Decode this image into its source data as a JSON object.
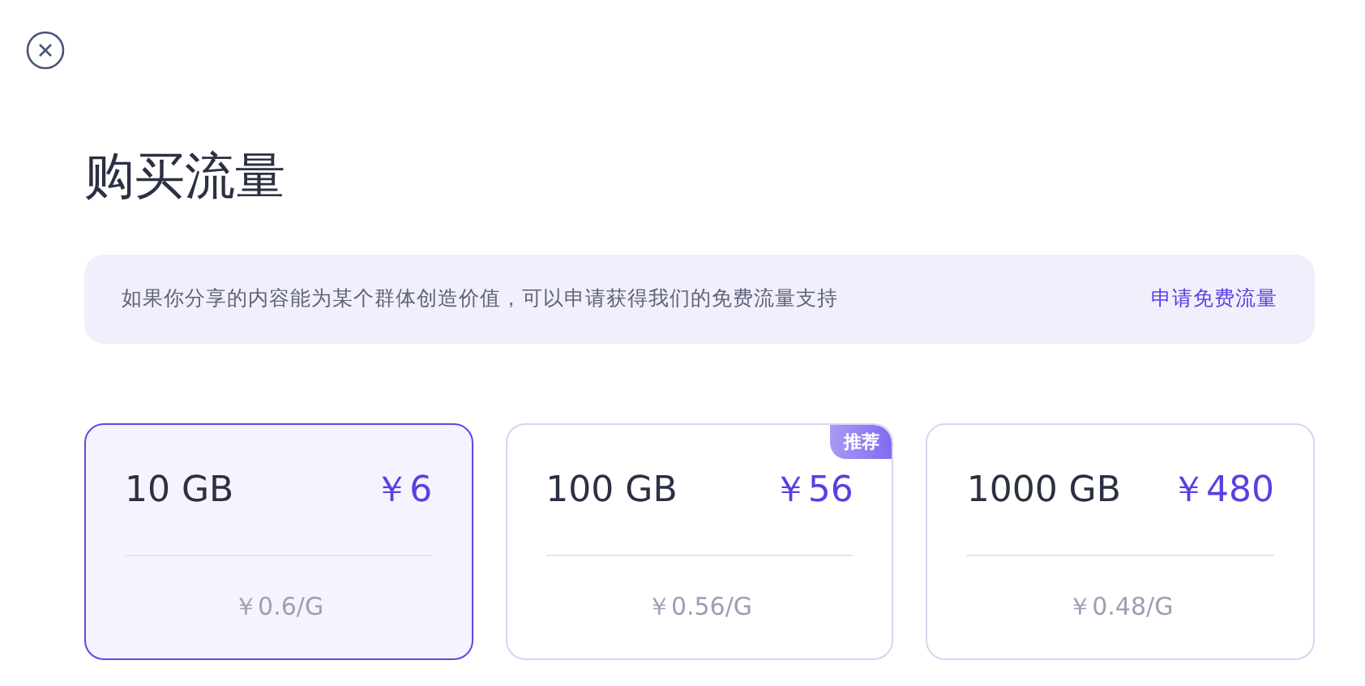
{
  "title": "购买流量",
  "notice": {
    "text": "如果你分享的内容能为某个群体创造价值，可以申请获得我们的免费流量支持",
    "link": "申请免费流量"
  },
  "plans": [
    {
      "size": "10 GB",
      "price": "￥6",
      "unit_price": "￥0.6/G",
      "selected": true
    },
    {
      "size": "100 GB",
      "price": "￥56",
      "unit_price": "￥0.56/G",
      "selected": false,
      "badge": "推荐"
    },
    {
      "size": "1000 GB",
      "price": "￥480",
      "unit_price": "￥0.48/G",
      "selected": false
    }
  ]
}
